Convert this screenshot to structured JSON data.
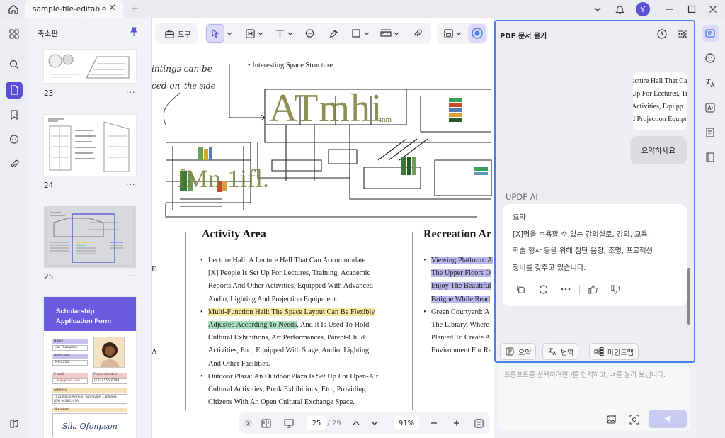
{
  "titlebar": {
    "tab_title": "sample-file-editable",
    "close": "✕",
    "new_tab": "+",
    "avatar_initial": "Y"
  },
  "thumbnails": {
    "title": "축소판",
    "pages": [
      {
        "label": "23",
        "more": "···"
      },
      {
        "label": "24",
        "more": "···"
      },
      {
        "label": "25",
        "more": "···"
      },
      {
        "label": "",
        "more": ""
      }
    ],
    "scholarship": {
      "title_line1": "Scholarship",
      "title_line2": "Application Form",
      "name_label": "Name",
      "name_value": "Lila Thompson",
      "birth_label": "Birth Date",
      "birth_value": "9/9/2010",
      "email_label": "E-mail",
      "email_value": "Lila@gmail.com",
      "phone_label": "Phone Number",
      "phone_value": "(502) 555-0198",
      "address_label": "Address",
      "address_value": "7425 Maple Avenue, Sunnyvale, California",
      "address_value2": "(CA) 94086, USA",
      "signature_label": "Signature",
      "signature_value": "Sila Ofonpson"
    }
  },
  "toolbar": {
    "tools_label": "도구"
  },
  "document": {
    "handwriting_1": "intings can be",
    "handwriting_2": "ced on",
    "handwriting_3": "the side",
    "annotation": "• Interesting Space Structure",
    "big_text_1": "ATmhi",
    "big_text_1_sub": "mm",
    "big_text_2": "fMn 1ifl.",
    "left_title": "Activity Area",
    "right_title": "Recreation Ar",
    "left_items": [
      {
        "lines": [
          "Lecture Hall: A Lecture Hall That Can Accommodate",
          "[X] People Is Set Up For Lectures, Training, Academic",
          "Reports And Other Activities, Equipped With Advanced",
          "Audio, Lighting And Projection Equipment."
        ]
      },
      {
        "hl_yellow_1": "Multi-Function Hall: The Space Layout Can Be Flexibly",
        "hl_green": "Adjusted According To Needs",
        "after_green": ", And It Is Used To Hold",
        "lines": [
          "Cultural Exhibitions, Art Performances, Parent-Child",
          "Activities, Etc., Equipped With Stage, Audio, Lighting",
          "And Other Facilities."
        ]
      },
      {
        "lines": [
          "Outdoor Plaza: An Outdoor Plaza Is Set Up For Open-Air",
          "Cultural Activities, Book Exhibitions, Etc., Providing",
          "Citizens With An Open Cultural Exchange Space."
        ]
      }
    ],
    "right_items": [
      {
        "hl_lines": [
          "Viewing Platform: A",
          "The Upper Floors O",
          "Enjoy The Beautiful",
          "Fatigue While Read"
        ]
      },
      {
        "lines": [
          "Green Courtyard: A",
          "The Library, Where",
          "Planted To Create A",
          "Environment For Re"
        ]
      }
    ],
    "edge_letters": [
      "E",
      "A"
    ]
  },
  "bottom_bar": {
    "page_current": "25",
    "page_total": "/ 29",
    "zoom": "91%"
  },
  "ai_panel": {
    "title": "PDF 문서 묻기",
    "user_context_lines": [
      "ecture Hall That Ca",
      "Up For Lectures, Tr",
      "Activities, Equipp",
      "d Projection Equipm"
    ],
    "user_message": "요약하세요",
    "ai_name": "UPDF AI",
    "answer_lines": [
      "요약:",
      "[X]명을 수용할 수 있는 강의실로, 강의, 교육,",
      "학술 행사 등을 위해 첨단 음향, 조명, 프로젝션",
      "장비를 갖추고 있습니다."
    ],
    "chips": [
      {
        "label": "요약",
        "icon": "summary-icon"
      },
      {
        "label": "번역",
        "icon": "translate-icon"
      },
      {
        "label": "마인드맵",
        "icon": "mindmap-icon"
      }
    ],
    "prompt_placeholder": "프롬프트를 선택하려면 /를 입력하고, ⮐를 눌러 보냅니다."
  }
}
